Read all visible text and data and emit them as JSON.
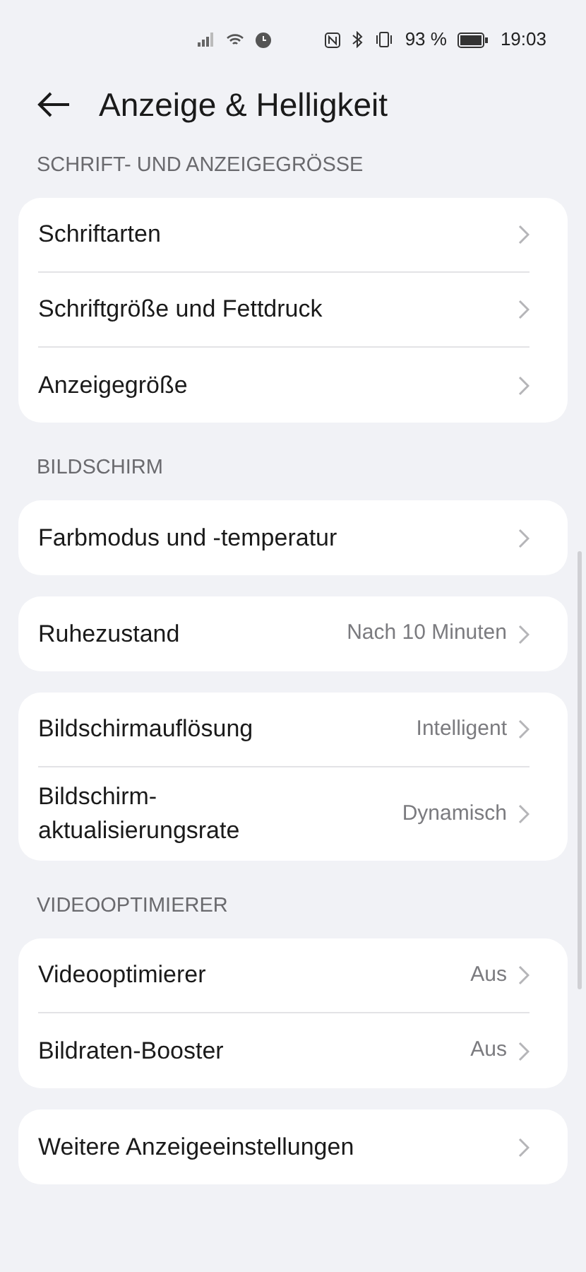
{
  "status_bar": {
    "battery": "93 %",
    "time": "19:03"
  },
  "header": {
    "title": "Anzeige & Helligkeit"
  },
  "sections": [
    {
      "heading": "SCHRIFT- UND ANZEIGEGRÖSSE",
      "cards": [
        [
          {
            "label": "Schriftarten"
          },
          {
            "label": "Schriftgröße und Fettdruck"
          },
          {
            "label": "Anzeigegröße"
          }
        ]
      ]
    },
    {
      "heading": "BILDSCHIRM",
      "cards": [
        [
          {
            "label": "Farbmodus und -temperatur"
          }
        ],
        [
          {
            "label": "Ruhezustand",
            "value": "Nach 10 Minuten"
          }
        ],
        [
          {
            "label": "Bildschirmauflösung",
            "value": "Intelligent"
          },
          {
            "label": "Bildschirm-\naktualisierungsrate",
            "value": "Dynamisch"
          }
        ]
      ]
    },
    {
      "heading": "VIDEOOPTIMIERER",
      "cards": [
        [
          {
            "label": "Videooptimierer",
            "value": "Aus"
          },
          {
            "label": "Bildraten-Booster",
            "value": "Aus"
          }
        ],
        [
          {
            "label": "Weitere Anzeigeeinstellungen"
          }
        ]
      ]
    }
  ]
}
